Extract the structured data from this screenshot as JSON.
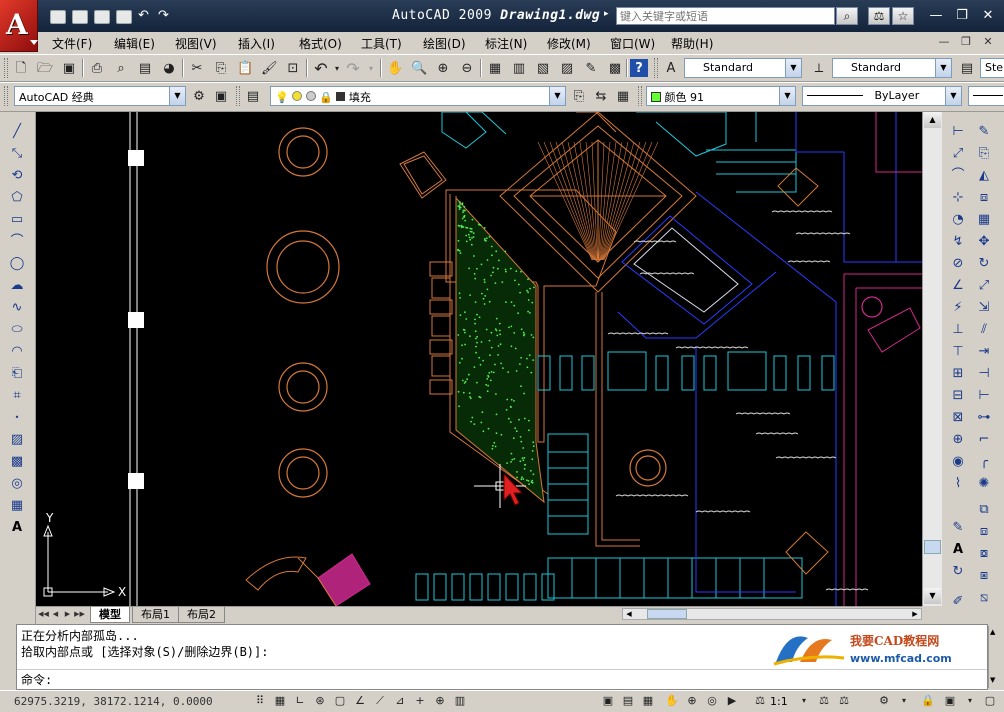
{
  "app": {
    "name_prefix": "AutoCAD 2009",
    "document": "Drawing1.dwg",
    "logo_letter": "A"
  },
  "search": {
    "placeholder": "键入关键字或短语"
  },
  "menus": [
    "文件(F)",
    "编辑(E)",
    "视图(V)",
    "插入(I)",
    "格式(O)",
    "工具(T)",
    "绘图(D)",
    "标注(N)",
    "修改(M)",
    "窗口(W)",
    "帮助(H)"
  ],
  "styles": {
    "text_style": "Standard",
    "dim_style": "Standard",
    "table_style_partial": "Ste"
  },
  "workspace": {
    "name": "AutoCAD 经典"
  },
  "layer": {
    "name": "填充",
    "color_label": "颜色 91",
    "color_hex": "#66ff33",
    "linetype": "ByLayer"
  },
  "layout_tabs": [
    "模型",
    "布局1",
    "布局2"
  ],
  "active_tab": "模型",
  "ucs": {
    "x_label": "X",
    "y_label": "Y"
  },
  "command": {
    "history_1": "正在分析内部孤岛...",
    "history_2": "拾取内部点或 [选择对象(S)/删除边界(B)]:",
    "prompt": "命令:"
  },
  "status": {
    "coordinates": "62975.3219, 38172.1214, 0.0000",
    "annotation_scale": "1:1"
  },
  "watermark": {
    "brand": "我要CAD教程网",
    "url": "www.mfcad.com"
  },
  "colors": {
    "canvas_bg": "#000000",
    "orange": "#d4783a",
    "cyan": "#21c6d8",
    "blue": "#2a3cff",
    "magenta": "#d02a8c",
    "crosshair": "#ffffff",
    "cursor": "#e02020"
  }
}
